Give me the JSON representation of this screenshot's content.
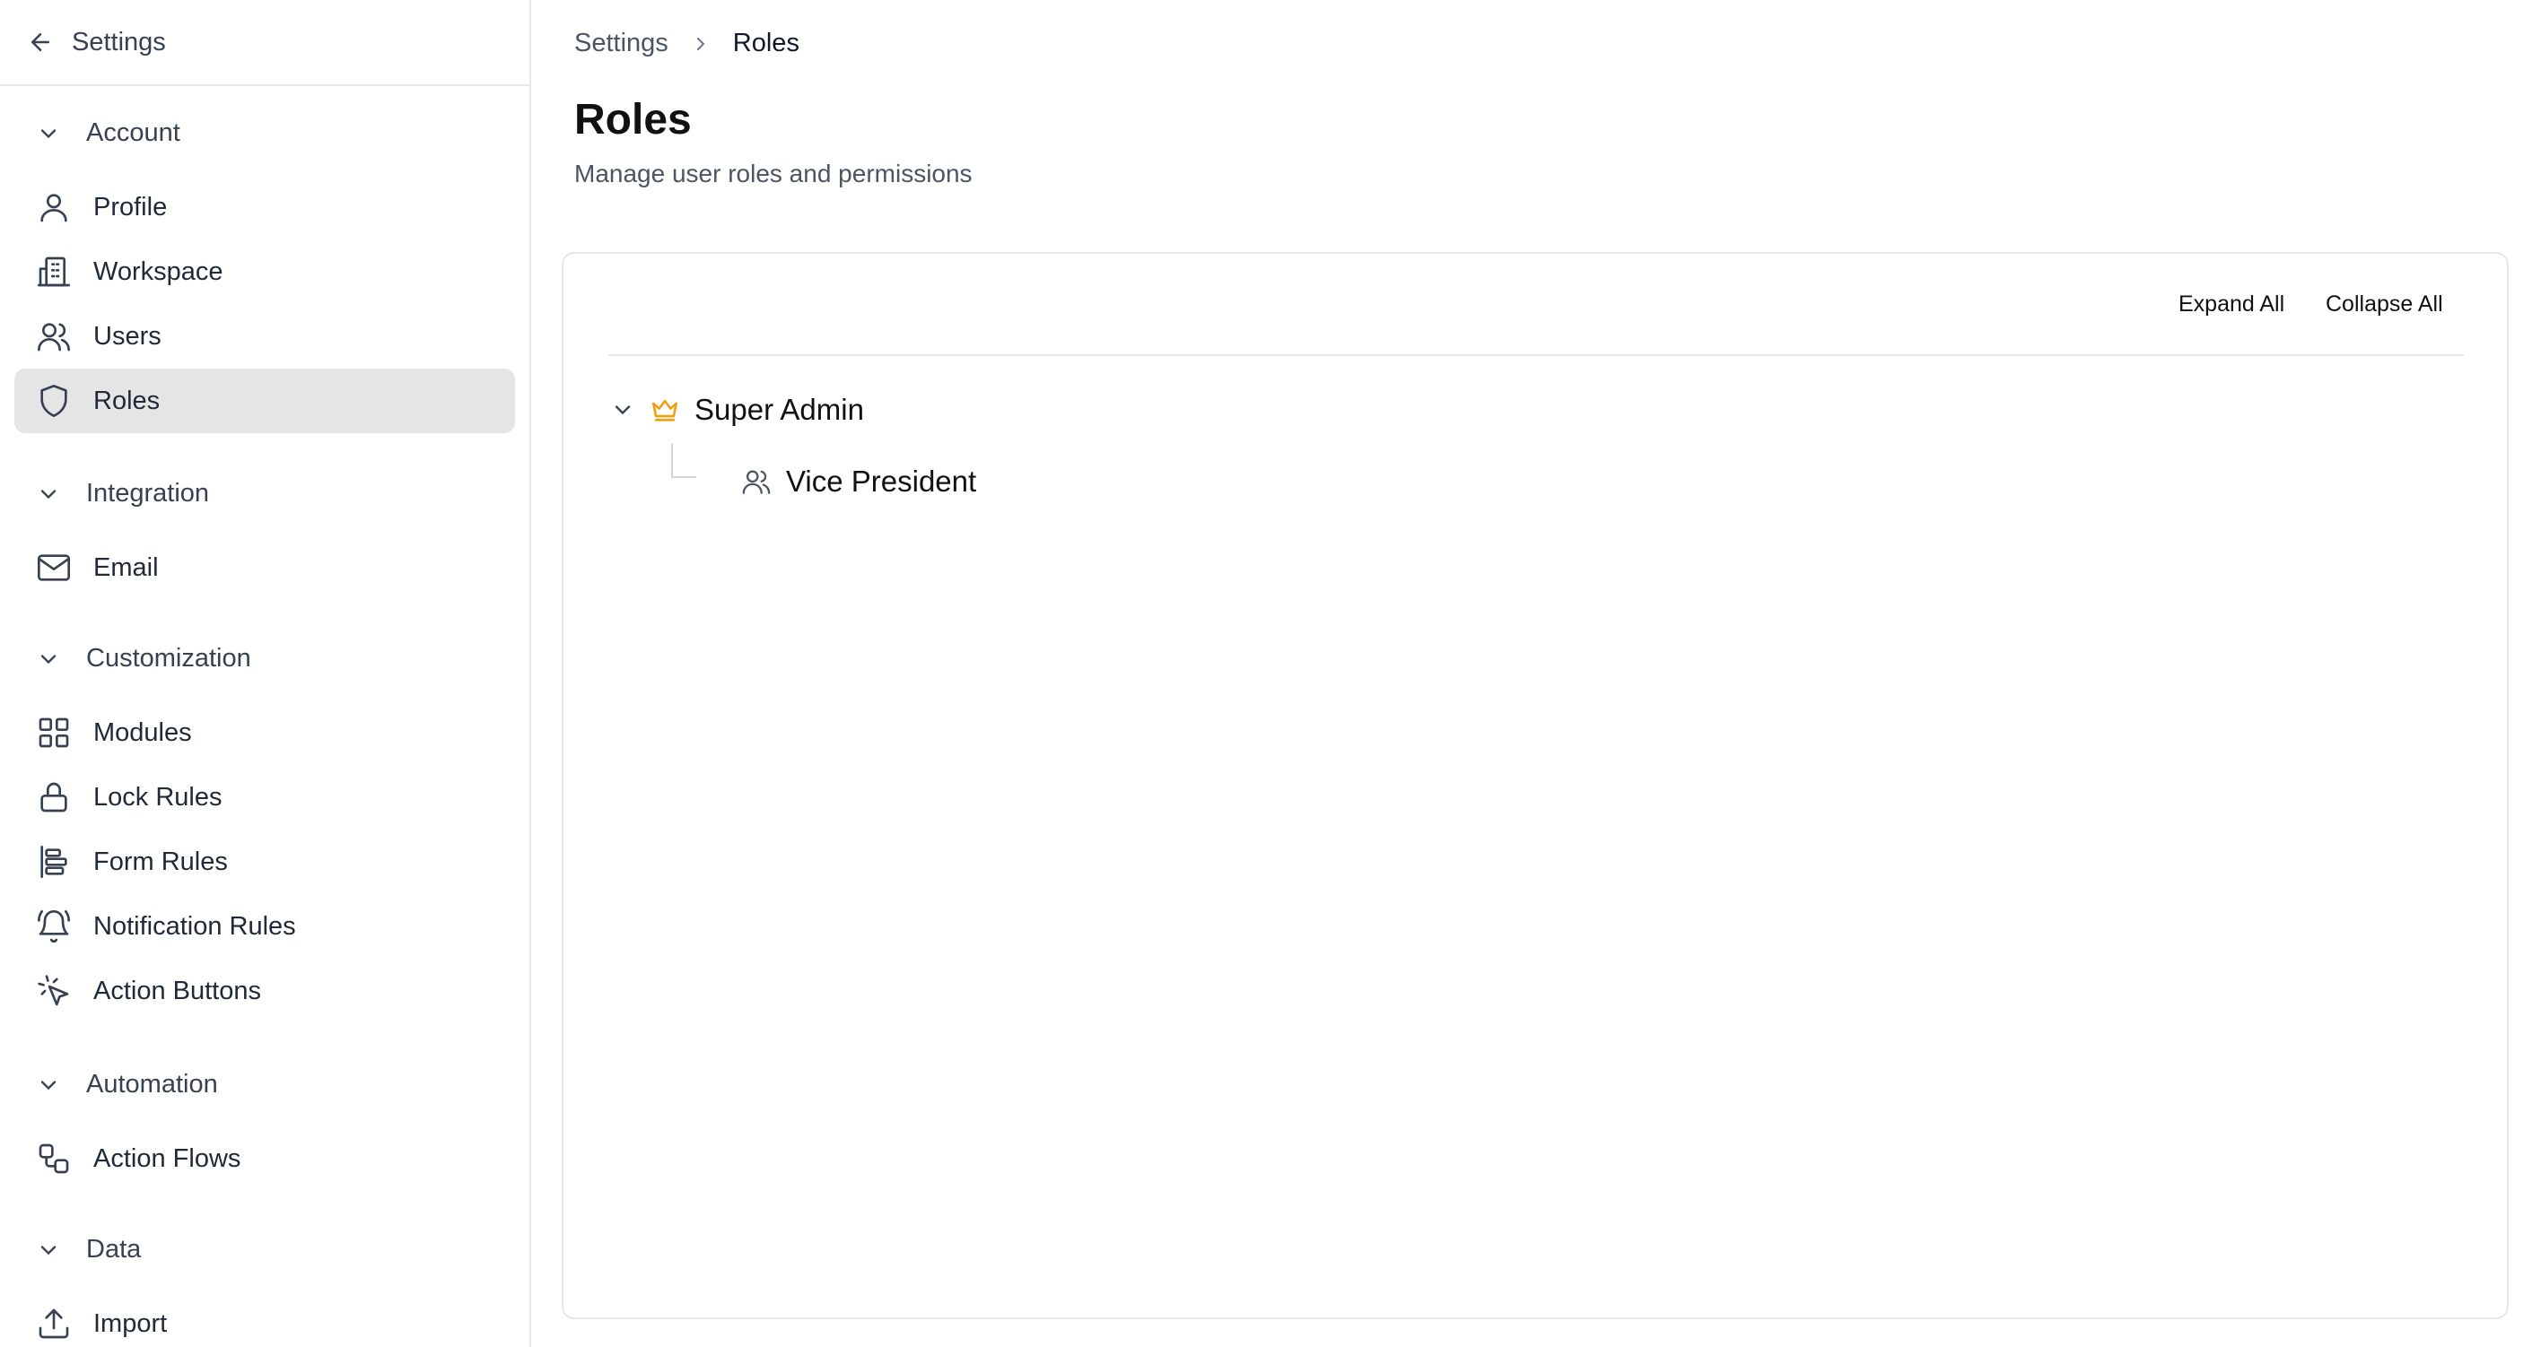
{
  "sidebar": {
    "back_label": "Settings",
    "groups": [
      {
        "label": "Account",
        "items": [
          {
            "label": "Profile",
            "icon": "user-icon"
          },
          {
            "label": "Workspace",
            "icon": "building-icon"
          },
          {
            "label": "Users",
            "icon": "users-icon"
          },
          {
            "label": "Roles",
            "icon": "shield-icon",
            "active": true
          }
        ]
      },
      {
        "label": "Integration",
        "items": [
          {
            "label": "Email",
            "icon": "mail-icon"
          }
        ]
      },
      {
        "label": "Customization",
        "items": [
          {
            "label": "Modules",
            "icon": "grid-icon"
          },
          {
            "label": "Lock Rules",
            "icon": "lock-icon"
          },
          {
            "label": "Form Rules",
            "icon": "align-left-icon"
          },
          {
            "label": "Notification Rules",
            "icon": "bell-ring-icon"
          },
          {
            "label": "Action Buttons",
            "icon": "pointer-click-icon"
          }
        ]
      },
      {
        "label": "Automation",
        "items": [
          {
            "label": "Action Flows",
            "icon": "workflow-icon"
          }
        ]
      },
      {
        "label": "Data",
        "items": [
          {
            "label": "Import",
            "icon": "upload-icon"
          }
        ]
      }
    ]
  },
  "breadcrumb": [
    "Settings",
    "Roles"
  ],
  "page": {
    "title": "Roles",
    "subtitle": "Manage user roles and permissions"
  },
  "toolbar": {
    "expand_all": "Expand All",
    "collapse_all": "Collapse All"
  },
  "tree": {
    "root": {
      "label": "Super Admin",
      "icon": "crown-icon",
      "icon_color": "#f59e0b"
    },
    "child": {
      "label": "Vice President",
      "icon": "users-icon"
    }
  }
}
